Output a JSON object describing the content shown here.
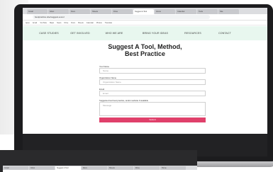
{
  "browser": {
    "tabs": [
      {
        "label": "Gmail"
      },
      {
        "label": "Inbox"
      },
      {
        "label": "Docs"
      },
      {
        "label": "Sheets"
      },
      {
        "label": "Drive"
      },
      {
        "label": "Suggest A Tool"
      },
      {
        "label": "Home"
      },
      {
        "label": "Calendar"
      },
      {
        "label": "Tools"
      },
      {
        "label": "Site"
      }
    ],
    "active_tab_index": 5,
    "url": "bestpractice.site/suggest-a-tool",
    "bookmarks": [
      "Apps",
      "Gmail",
      "YouTube",
      "Maps",
      "News",
      "Drive",
      "Docs",
      "Sheets",
      "Calendar",
      "Photos",
      "Translate"
    ]
  },
  "site_nav": {
    "items": [
      "CASE STUDIES",
      "GET INVOLVED",
      "WHO WE ARE",
      "BRING YOUR IDEAS",
      "RESOURCES",
      "CONTACT"
    ]
  },
  "heading": {
    "line1": "Suggest A Tool, Method,",
    "line2": "Best Practice"
  },
  "form": {
    "name_label": "Your Name",
    "name_placeholder": "Name",
    "org_label": "Organization Name",
    "org_placeholder": "Organization Name",
    "email_label": "Email",
    "email_placeholder": "Email",
    "message_label": "Suggested tool best practice, and/or website if available",
    "message_placeholder": "Message",
    "submit_label": "Submit"
  },
  "second_window": {
    "tabs": [
      {
        "label": "Gmail"
      },
      {
        "label": "Inbox"
      },
      {
        "label": "Suggest A Tool"
      },
      {
        "label": "Docs"
      },
      {
        "label": "Sheets"
      },
      {
        "label": "Drive"
      },
      {
        "label": "Home"
      }
    ],
    "active_tab_index": 2
  },
  "colors": {
    "nav_bg": "#e8f7ef",
    "submit": "#e0406b",
    "footer": "#222224",
    "bezel": "#1c1c1e"
  }
}
